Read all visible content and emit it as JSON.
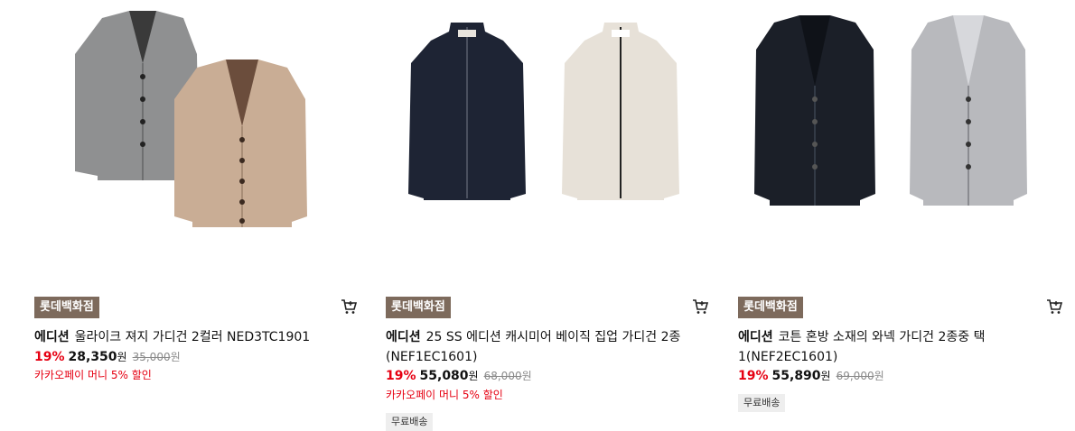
{
  "colors": {
    "badge_bg": "#7d6a5c",
    "discount_red": "#e60012",
    "promo_red": "#e60012",
    "shipping_bg": "#eeeeee"
  },
  "products": [
    {
      "store_badge": "롯데백화점",
      "brand": "에디션",
      "name": "울라이크 져지 가디건 2컬러 NED3TC1901",
      "discount_rate": "19%",
      "price": "28,350",
      "price_unit": "원",
      "original_price": "35,000",
      "original_unit": "원",
      "promo": "카카오페이 머니 5% 할인",
      "cart_icon": "cart-icon"
    },
    {
      "store_badge": "롯데백화점",
      "brand": "에디션",
      "name": "25 SS 에디션 캐시미어 베이직 집업 가디건 2종 (NEF1EC1601)",
      "discount_rate": "19%",
      "price": "55,080",
      "price_unit": "원",
      "original_price": "68,000",
      "original_unit": "원",
      "promo": "카카오페이 머니 5% 할인",
      "shipping": "무료배송",
      "cart_icon": "cart-icon"
    },
    {
      "store_badge": "롯데백화점",
      "brand": "에디션",
      "name": "코튼 혼방 소재의 와넥 가디건 2종중 택1(NEF2EC1601)",
      "discount_rate": "19%",
      "price": "55,890",
      "price_unit": "원",
      "original_price": "69,000",
      "original_unit": "원",
      "shipping": "무료배송",
      "cart_icon": "cart-icon"
    }
  ]
}
